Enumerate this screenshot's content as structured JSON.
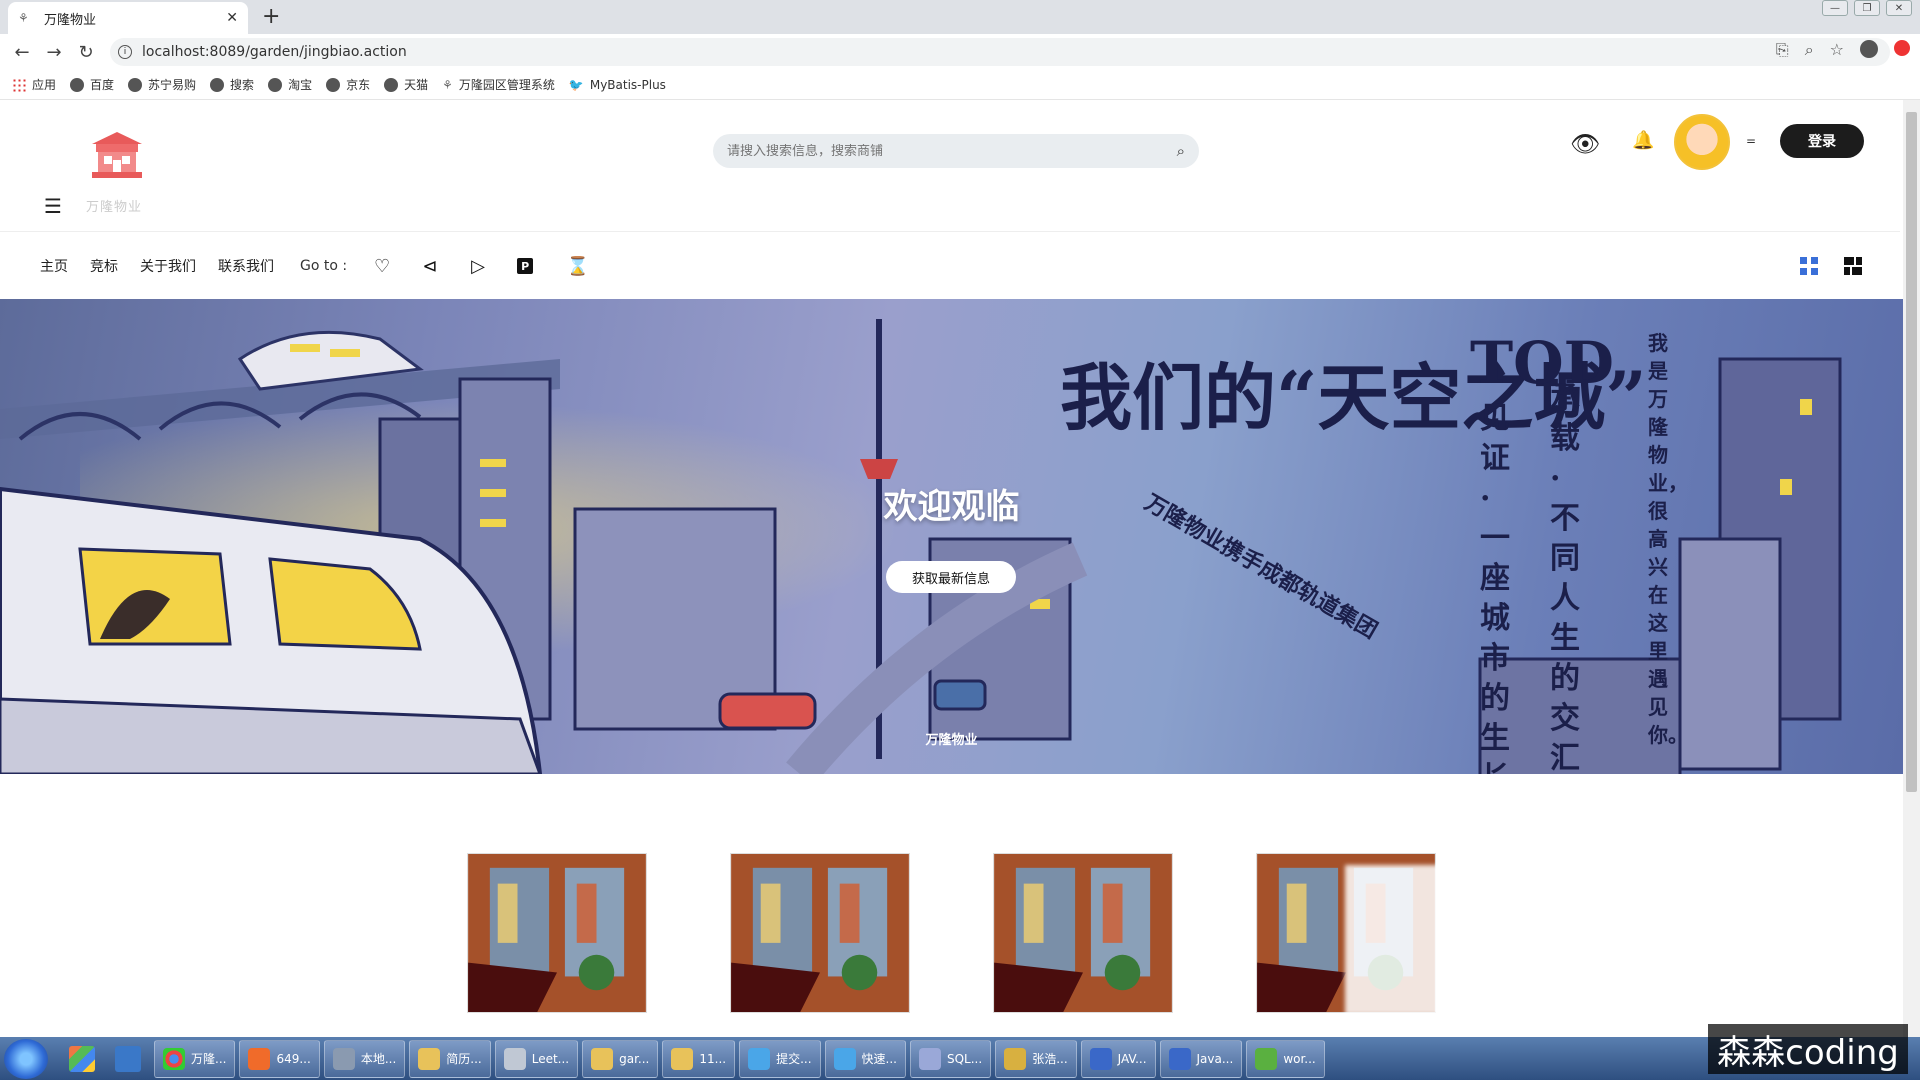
{
  "browser": {
    "tab_title": "万隆物业",
    "url": "localhost:8089/garden/jingbiao.action",
    "bookmarks": [
      "应用",
      "百度",
      "苏宁易购",
      "搜索",
      "淘宝",
      "京东",
      "天猫",
      "万隆园区管理系统",
      "MyBatis-Plus"
    ]
  },
  "site": {
    "logo_text": "万隆物业",
    "search_placeholder": "请搜入搜索信息，搜索商铺",
    "login_label": "登录",
    "dots": "=",
    "nav": {
      "items": [
        "主页",
        "竞标",
        "关于我们",
        "联系我们"
      ],
      "goto_label": "Go to :"
    },
    "hero": {
      "title": "欢迎观临",
      "button": "获取最新信息",
      "caption": "万隆物业",
      "art_text_1": "我们的“天空之城”",
      "art_text_2": "TOD",
      "art_text_3": "见证·一座城市的生长",
      "art_text_4": "承载·不同人生的交汇",
      "art_text_5": "我是万隆物业，很高兴在这里遇见你。",
      "art_text_6": "万隆物业携手成都轨道集团"
    }
  },
  "taskbar": {
    "items": [
      "万隆...",
      "649...",
      "本地...",
      "简历...",
      "Leet...",
      "gar...",
      "11...",
      "提交...",
      "快速...",
      "SQL...",
      "张浩...",
      "JAV...",
      "Java...",
      "wor..."
    ],
    "watermark": "森森coding"
  }
}
